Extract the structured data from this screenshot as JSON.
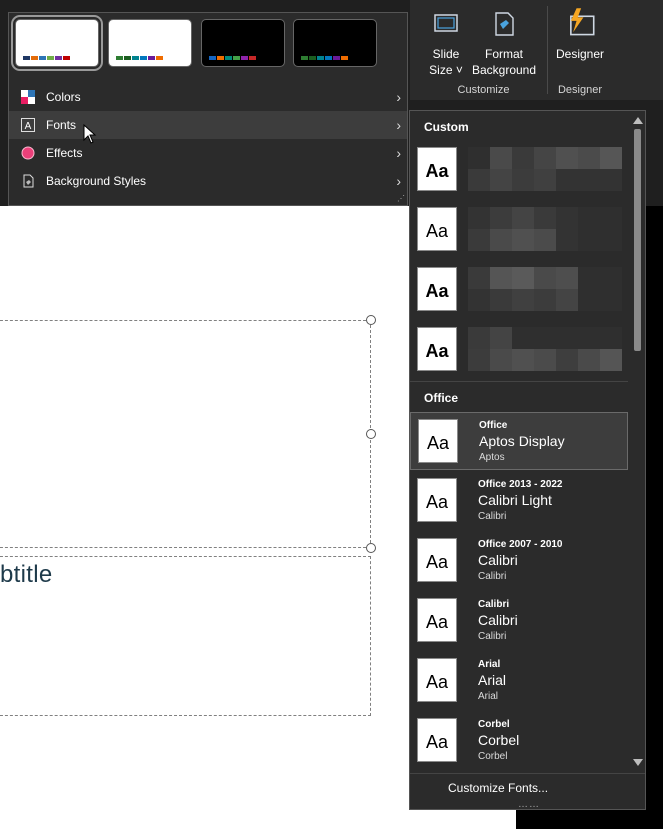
{
  "ribbon": {
    "slide_size_label_1": "Slide",
    "slide_size_label_2": "Size ˅",
    "format_background_label_1": "Format",
    "format_background_label_2": "Background",
    "designer_label": "Designer",
    "group_customize": "Customize",
    "group_designer": "Designer"
  },
  "variants_menu": {
    "thumbnails": [
      {
        "name": "white-variant-1",
        "bg": "#ffffff",
        "selected": true
      },
      {
        "name": "white-variant-2",
        "bg": "#ffffff",
        "selected": false
      },
      {
        "name": "black-variant-1",
        "bg": "#000000",
        "selected": false
      },
      {
        "name": "black-variant-2",
        "bg": "#000000",
        "selected": false
      }
    ],
    "items": [
      {
        "label": "Colors",
        "icon": "colors-icon"
      },
      {
        "label": "Fonts",
        "icon": "fonts-icon"
      },
      {
        "label": "Effects",
        "icon": "effects-icon"
      },
      {
        "label": "Background Styles",
        "icon": "background-styles-icon"
      }
    ]
  },
  "fonts_panel": {
    "custom_header": "Custom",
    "office_header": "Office",
    "office_fonts": [
      {
        "name": "Office",
        "heading": "Aptos Display",
        "body": "Aptos"
      },
      {
        "name": "Office 2013 - 2022",
        "heading": "Calibri Light",
        "body": "Calibri"
      },
      {
        "name": "Office 2007 - 2010",
        "heading": "Calibri",
        "body": "Calibri"
      },
      {
        "name": "Calibri",
        "heading": "Calibri",
        "body": "Calibri"
      },
      {
        "name": "Arial",
        "heading": "Arial",
        "body": "Arial"
      },
      {
        "name": "Corbel",
        "heading": "Corbel",
        "body": "Corbel"
      }
    ],
    "aa_label": "Aa",
    "customize_label": "Customize Fonts..."
  },
  "slide": {
    "subtitle_text": "btitle"
  }
}
